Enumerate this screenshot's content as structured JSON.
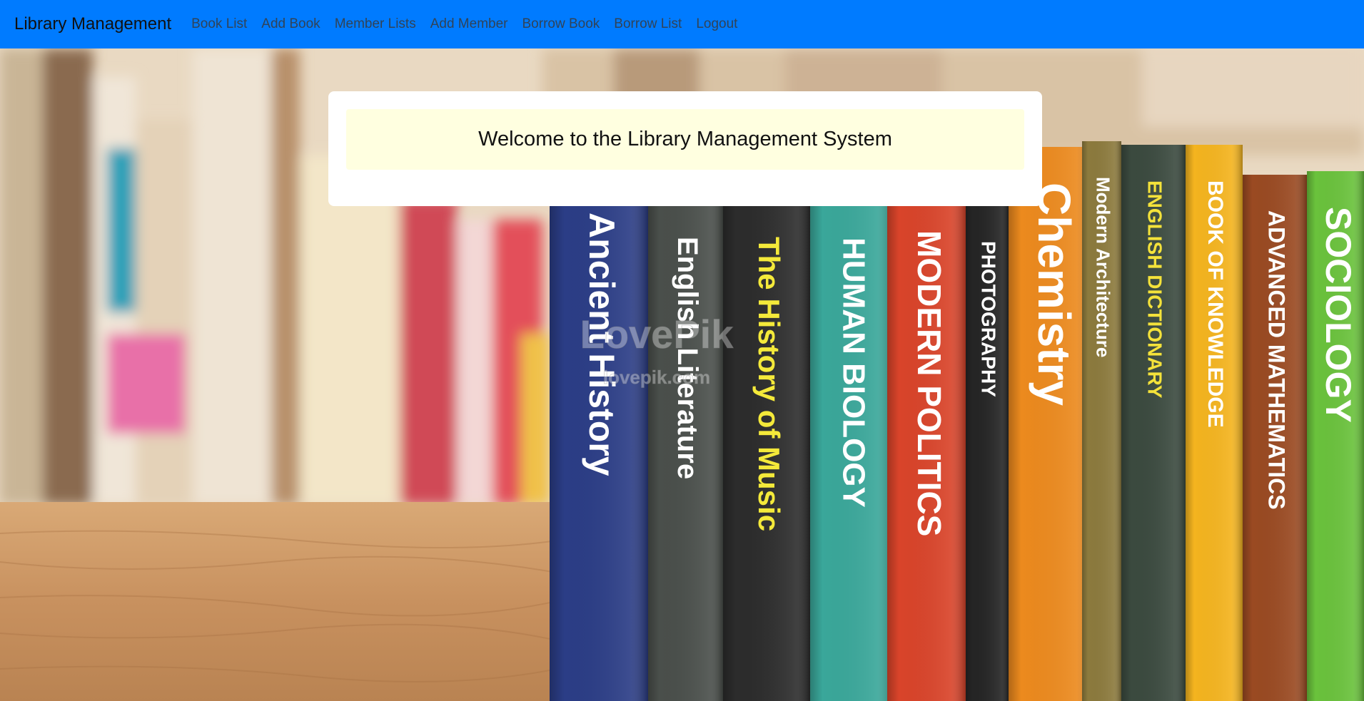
{
  "nav": {
    "brand": "Library Management",
    "links": [
      "Book List",
      "Add Book",
      "Member Lists",
      "Add Member",
      "Borrow Book",
      "Borrow List",
      "Logout"
    ]
  },
  "main": {
    "welcome": "Welcome to the Library Management System"
  },
  "background": {
    "books": [
      {
        "title": "Ancient History",
        "color": "#2b3d86",
        "text_color": "#ffffff"
      },
      {
        "title": "English Literature",
        "color": "#4a4f4b",
        "text_color": "#ffffff"
      },
      {
        "title": "The History of Music",
        "color": "#2c2c2c",
        "text_color": "#f4e93a"
      },
      {
        "title": "HUMAN BIOLOGY",
        "color": "#3aa79a",
        "text_color": "#ffffff"
      },
      {
        "title": "MODERN POLITICS",
        "color": "#d9442a",
        "text_color": "#ffffff"
      },
      {
        "title": "PHOTOGRAPHY",
        "color": "#252525",
        "text_color": "#ffffff"
      },
      {
        "title": "Chemistry",
        "color": "#ec8a1e",
        "text_color": "#ffffff"
      },
      {
        "title": "Modern Architecture",
        "color": "#8c7a3d",
        "text_color": "#ffffff"
      },
      {
        "title": "ENGLISH DICTIONARY",
        "color": "#3b4a3f",
        "text_color": "#f4e23a"
      },
      {
        "title": "BOOK OF KNOWLEDGE",
        "color": "#f4b41f",
        "text_color": "#ffffff"
      },
      {
        "title": "ADVANCED MATHEMATICS",
        "color": "#9a4a22",
        "text_color": "#ffffff"
      },
      {
        "title": "SOCIOLOGY",
        "color": "#6ac23c",
        "text_color": "#ffffff"
      }
    ],
    "watermark": "LovePik",
    "watermark_sub": "lovepik.com"
  }
}
